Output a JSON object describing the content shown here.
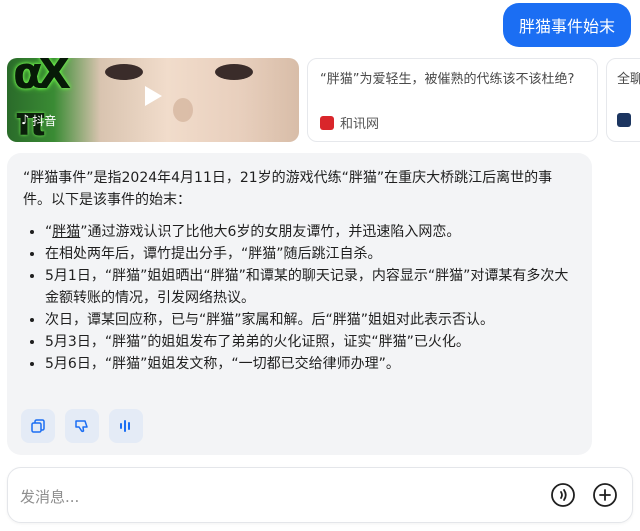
{
  "user_message": "胖猫事件始末",
  "sources": [
    {
      "type": "video",
      "source_name": "抖音"
    },
    {
      "title": "“胖猫”为爱轻生，被催熟的代练该不该杜绝?",
      "source_name": "和讯网",
      "icon_color": "#d9262b"
    },
    {
      "title": "全聊",
      "source_name": "",
      "icon_color": "#1c3560"
    }
  ],
  "answer": {
    "intro": "“胖猫事件”是指2024年4月11日，21岁的游戏代练“胖猫”在重庆大桥跳江后离世的事件。以下是该事件的始末：",
    "item1_quote_open": "“",
    "item1_link": "胖猫",
    "item1_rest": "”通过游戏认识了比他大6岁的女朋友谭竹，并迅速陷入网恋。",
    "items": [
      "在相处两年后，谭竹提出分手，“胖猫”随后跳江自杀。",
      "5月1日，“胖猫”姐姐晒出“胖猫”和谭某的聊天记录，内容显示“胖猫”对谭某有多次大金额转账的情况，引发网络热议。",
      "次日，谭某回应称，已与“胖猫”家属和解。后“胖猫”姐姐对此表示否认。",
      "5月3日，“胖猫”的姐姐发布了弟弟的火化证照，证实“胖猫”已火化。",
      "5月6日，“胖猫”姐姐发文称，“一切都已交给律师办理”。"
    ]
  },
  "input": {
    "placeholder": "发消息..."
  },
  "colors": {
    "accent": "#1b6ef3",
    "bubble_bg": "#f3f4f6",
    "action_bg": "#e4ebf6"
  }
}
